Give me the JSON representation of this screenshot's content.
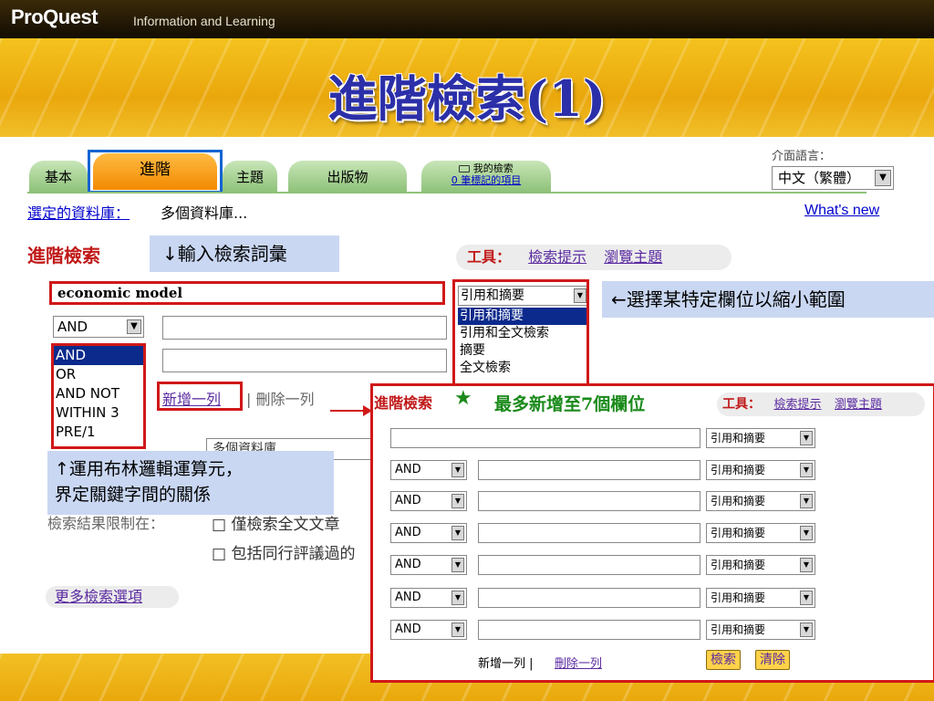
{
  "header": {
    "brand": "ProQuest",
    "brand_sub": "Information and Learning",
    "slide_title": "進階檢索(1)"
  },
  "tabs": {
    "basic": "基本",
    "advanced": "進階",
    "subject": "主題",
    "publications": "出版物",
    "my_search_line1": "我的檢索",
    "my_search_line2": "0 筆標記的項目"
  },
  "interface_language": {
    "label": "介面語言：",
    "value": "中文（繁體）"
  },
  "database": {
    "label": "選定的資料庫：",
    "value": "多個資料庫..."
  },
  "whats_new": "What's new",
  "adv_heading": "進階檢索",
  "tools": {
    "label": "工具：",
    "search_tips": "檢索提示",
    "browse_topics": "瀏覽主題"
  },
  "annotations": {
    "input_terms": "↓輸入檢索詞彙",
    "select_field": "←選擇某特定欄位以縮小範圍",
    "boolean_line1": "↑運用布林邏輯運算元，",
    "boolean_line2": "界定關鍵字間的關係",
    "max_rows": "最多新增至7個欄位"
  },
  "form": {
    "keyword": "economic model",
    "boolean_selected": "AND",
    "boolean_options": [
      "AND",
      "OR",
      "AND NOT",
      "WITHIN 3",
      "PRE/1"
    ],
    "add_row": "新增一列",
    "delete_row": "刪除一列",
    "db_field_value": "多個資料庫",
    "limit_label": "檢索結果限制在：",
    "fulltext_only": "僅檢索全文文章",
    "peer_reviewed": "包括同行評議過的",
    "more_options": "更多檢索選項"
  },
  "field_list": {
    "selected": "引用和摘要",
    "options": [
      "引用和摘要",
      "引用和全文檢索",
      "摘要",
      "全文檢索"
    ]
  },
  "popup": {
    "heading": "進階檢索",
    "star": "★",
    "tools_label": "工具：",
    "search_tips": "檢索提示",
    "browse_topics": "瀏覽主題",
    "rows": [
      {
        "op": "",
        "field": "引用和摘要"
      },
      {
        "op": "AND",
        "field": "引用和摘要"
      },
      {
        "op": "AND",
        "field": "引用和摘要"
      },
      {
        "op": "AND",
        "field": "引用和摘要"
      },
      {
        "op": "AND",
        "field": "引用和摘要"
      },
      {
        "op": "AND",
        "field": "引用和摘要"
      },
      {
        "op": "AND",
        "field": "引用和摘要"
      }
    ],
    "add_row": "新增一列",
    "delete_row": "刪除一列",
    "search_button": "檢索",
    "clear_button": "清除"
  },
  "colors": {
    "accent_red": "#d01818",
    "highlight_blue": "#1464d2",
    "annotation_bg": "#c9d7f2",
    "title_blue": "#2b2fa8"
  }
}
